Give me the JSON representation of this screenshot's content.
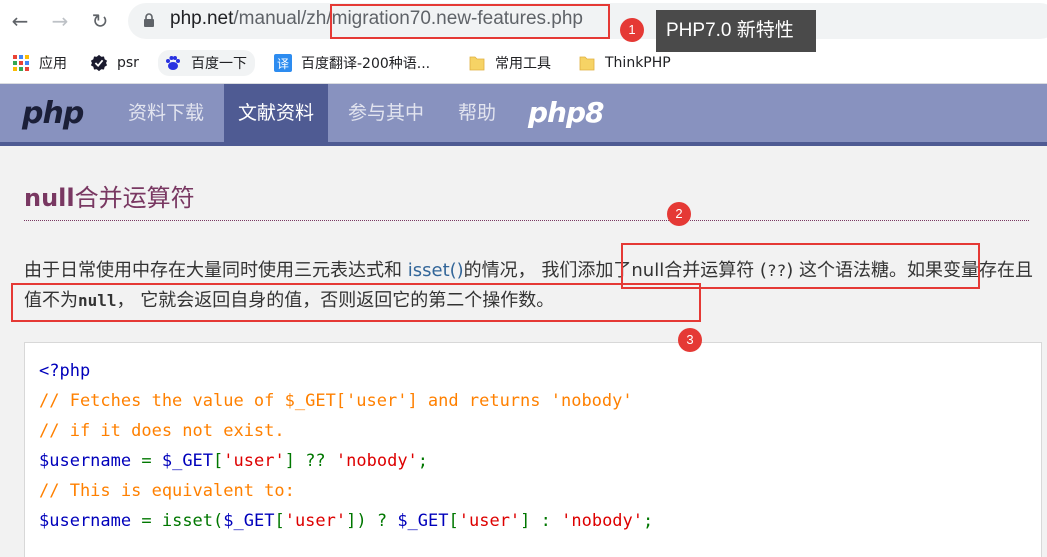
{
  "browser": {
    "url_domain": "php.net",
    "url_path": "/manual/zh/migration70.new-features.php",
    "bookmarks": [
      {
        "label": "应用",
        "icon": "apps-grid-icon"
      },
      {
        "label": "psr",
        "icon": "verified-check-icon"
      },
      {
        "label": "百度一下",
        "icon": "baidu-paw-icon"
      },
      {
        "label": "百度翻译-200种语...",
        "icon": "translate-icon"
      },
      {
        "label": "常用工具",
        "icon": "folder-icon"
      },
      {
        "label": "ThinkPHP",
        "icon": "folder-icon"
      }
    ]
  },
  "phpnav": {
    "logo": "php",
    "items": [
      "资料下载",
      "文献资料",
      "参与其中",
      "帮助"
    ],
    "active": "文献资料",
    "php8_logo": "php8"
  },
  "content": {
    "title_bold": "null",
    "title_rest": "合并运算符",
    "para_part1": "由于日常使用中存在大量同时使用三元表达式和 ",
    "para_link": "isset()",
    "para_part2": "的情况， 我们添加了null合并运算符 (",
    "para_op": "??",
    "para_part3": ") 这个语法糖。如果变量存在且值不为",
    "para_null": "null",
    "para_part4": "， 它就会返回自身的值，否则返回它的第二个操作数。"
  },
  "code": {
    "line1": "<?php",
    "line2": "// Fetches the value of $_GET['user'] and returns 'nobody'",
    "line3": "// if it does not exist.",
    "line4_var": "$username",
    "line4_eq": " = ",
    "line4_get": "$_GET",
    "line4_b1": "[",
    "line4_key": "'user'",
    "line4_b2": "] ",
    "line4_op": "?? ",
    "line4_str": "'nobody'",
    "line4_end": ";",
    "line5": "// This is equivalent to:",
    "line6_var": "$username",
    "line6_eq": " = ",
    "line6_isset": "isset(",
    "line6_get": "$_GET",
    "line6_b1": "[",
    "line6_key": "'user'",
    "line6_b2": "]) ? ",
    "line6_get2": "$_GET",
    "line6_b3": "[",
    "line6_key2": "'user'",
    "line6_b4": "] : ",
    "line6_str": "'nobody'",
    "line6_end": ";"
  },
  "annotations": {
    "badge1": "1",
    "badge2": "2",
    "badge3": "3",
    "tooltip": "PHP7.0 新特性"
  },
  "colors": {
    "nav_bg": "#8892bf",
    "nav_active": "#4f5b93",
    "title": "#793862",
    "annotation_red": "#e53935"
  }
}
